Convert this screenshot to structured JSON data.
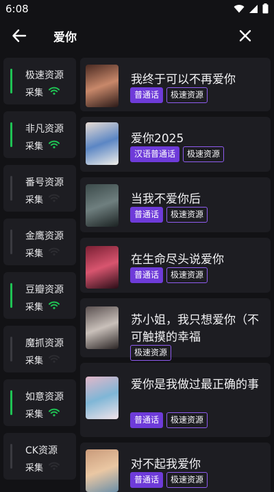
{
  "status_bar": {
    "time": "6:08"
  },
  "appbar": {
    "title": "爱你"
  },
  "sources": [
    {
      "name": "极速资源",
      "status": "采集",
      "active": true
    },
    {
      "name": "非凡资源",
      "status": "采集",
      "active": true
    },
    {
      "name": "番号资源",
      "status": "采集",
      "active": false
    },
    {
      "name": "金鹰资源",
      "status": "采集",
      "active": false
    },
    {
      "name": "豆瓣资源",
      "status": "采集",
      "active": true
    },
    {
      "name": "魔抓资源",
      "status": "采集",
      "active": false
    },
    {
      "name": "如意资源",
      "status": "采集",
      "active": true
    },
    {
      "name": "CK资源",
      "status": "采集",
      "active": false
    }
  ],
  "results": [
    {
      "title": "我终于可以不再爱你",
      "tags": [
        "普通话",
        "极速资源"
      ]
    },
    {
      "title": "爱你2025",
      "tags": [
        "汉语普通话",
        "极速资源"
      ]
    },
    {
      "title": "当我不爱你后",
      "tags": [
        "普通话",
        "极速资源"
      ]
    },
    {
      "title": "在生命尽头说爱你",
      "tags": [
        "普通话",
        "极速资源"
      ]
    },
    {
      "title": "苏小姐，我只想爱你（不可触摸的幸福",
      "tags": [
        "极速资源"
      ]
    },
    {
      "title": "爱你是我做过最正确的事",
      "tags": [
        "普通话",
        "极速资源"
      ]
    },
    {
      "title": "对不起我爱你",
      "tags": [
        "普通话",
        "极速资源"
      ]
    }
  ],
  "colors": {
    "accent": "#6e3bd9",
    "active_green": "#1fc254"
  },
  "icons": {
    "back": "arrow-left-icon",
    "close": "close-icon",
    "signal": "wifi-icon"
  }
}
